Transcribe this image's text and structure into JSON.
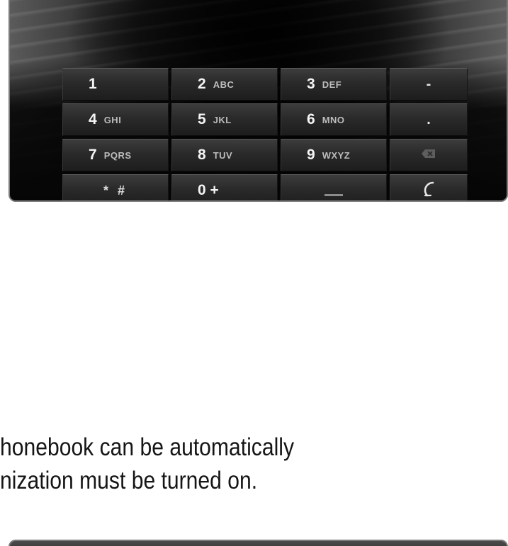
{
  "keypad": {
    "keys": [
      {
        "num": "1",
        "sub": ""
      },
      {
        "num": "2",
        "sub": "ABC"
      },
      {
        "num": "3",
        "sub": "DEF"
      },
      {
        "num": "-",
        "sub": ""
      },
      {
        "num": "4",
        "sub": "GHI"
      },
      {
        "num": "5",
        "sub": "JKL"
      },
      {
        "num": "6",
        "sub": "MNO"
      },
      {
        "num": ".",
        "sub": ""
      },
      {
        "num": "7",
        "sub": "PQRS"
      },
      {
        "num": "8",
        "sub": "TUV"
      },
      {
        "num": "9",
        "sub": "WXYZ"
      },
      {
        "num": "",
        "sub": ""
      },
      {
        "num": "* #",
        "sub": ""
      },
      {
        "num": "0 +",
        "sub": ""
      },
      {
        "num": "",
        "sub": ""
      },
      {
        "num": "",
        "sub": ""
      }
    ],
    "icons": {
      "backspace": "backspace-icon",
      "call": "call-icon",
      "space": "space-icon"
    }
  },
  "text": {
    "line1": "honebook can be automatically",
    "line2": "nization must be turned on."
  },
  "colors": {
    "screen_bg": "#0e0e0e",
    "key_top": "#3c3c3c",
    "key_bottom": "#1d1d1d",
    "key_text": "#f5f5f5",
    "sub_text": "#bdbdbd",
    "body_text": "#151515",
    "frame": "#7a7a7a"
  }
}
